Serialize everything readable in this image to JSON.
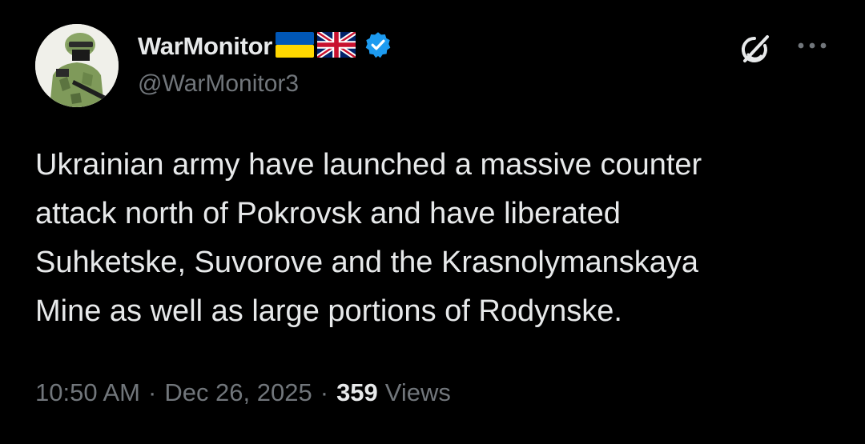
{
  "author": {
    "display_name": "WarMonitor",
    "handle": "@WarMonitor3",
    "flags": [
      "ukraine-flag",
      "united-kingdom-flag"
    ],
    "verified": true,
    "verified_color": "#1d9bf0"
  },
  "tweet": {
    "text": "Ukrainian army have launched a massive counter\nattack north of Pokrovsk and have liberated\nSuhketske, Suvorove and the Krasnolymanskaya\nMine as well as large portions of Rodynske.",
    "time": "10:50 AM",
    "date": "Dec 26, 2025",
    "separator": "·",
    "views_count": "359",
    "views_label": "Views"
  },
  "icons": {
    "grok": "grok-icon",
    "more": "more-options-icon",
    "verified": "verified-badge-icon"
  },
  "colors": {
    "background": "#000000",
    "primary_text": "#e7e9ea",
    "secondary_text": "#71767b",
    "accent": "#1d9bf0"
  }
}
